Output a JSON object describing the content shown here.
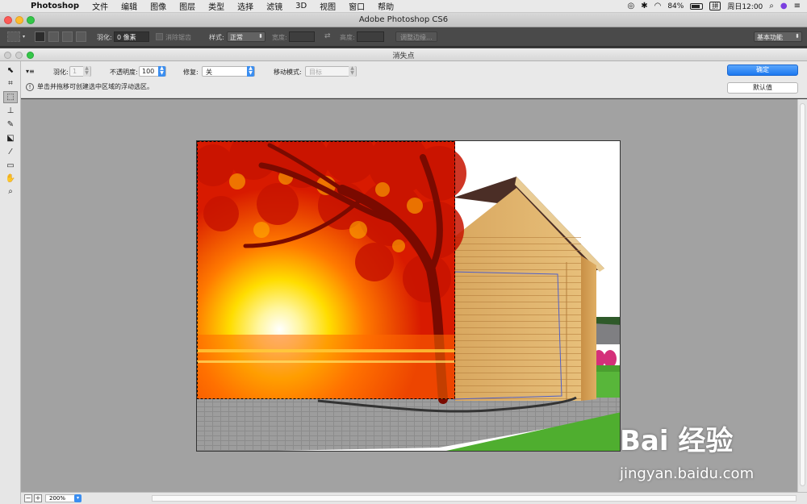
{
  "menubar": {
    "app_name": "Photoshop",
    "menus": [
      "文件",
      "编辑",
      "图像",
      "图层",
      "类型",
      "选择",
      "滤镜",
      "3D",
      "视图",
      "窗口",
      "帮助"
    ],
    "battery": "84%",
    "ime": "拼",
    "clock": "周日12:00"
  },
  "ps_window": {
    "title": "Adobe Photoshop CS6",
    "options": {
      "feather_label": "羽化:",
      "feather_value": "0 像素",
      "antialias_label": "消除锯齿",
      "style_label": "样式:",
      "style_value": "正常",
      "width_label": "宽度:",
      "height_label": "高度:",
      "refine_edge": "调整边缘...",
      "workspace": "基本功能"
    }
  },
  "vp_dialog": {
    "title": "消失点",
    "feather_label": "羽化:",
    "feather_value": "1",
    "opacity_label": "不透明度:",
    "opacity_value": "100",
    "heal_label": "修复:",
    "heal_value": "关",
    "move_mode_label": "移动模式:",
    "move_mode_value": "目标",
    "hint": "单击并拖移可创建选中区域的浮动选区。",
    "ok_label": "确定",
    "default_label": "默认值",
    "zoom_value": "200%",
    "zoom_out": "−",
    "zoom_in": "+"
  },
  "watermark": {
    "brand": "Bai 经验",
    "url": "jingyan.baidu.com"
  },
  "colors": {
    "accent": "#1c78f0",
    "canvas_bg": "#a2a2a2"
  }
}
